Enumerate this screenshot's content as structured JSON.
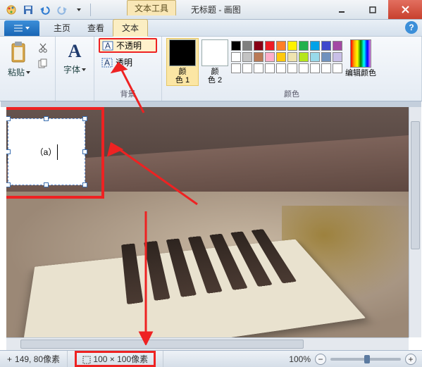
{
  "titlebar": {
    "tool_tab": "文本工具",
    "doc_title": "无标题",
    "app_name": "画图"
  },
  "tabs": {
    "file_indicator": "▾",
    "home": "主页",
    "view": "查看",
    "text": "文本"
  },
  "help_label": "?",
  "ribbon": {
    "clipboard": {
      "paste": "粘贴",
      "label": ""
    },
    "font": {
      "button": "字体",
      "label": ""
    },
    "background": {
      "opaque": "不透明",
      "transparent": "透明",
      "label": "背景"
    },
    "color1_label": "颜\n色 1",
    "color2_label": "颜\n色 2",
    "edit_colors": "编辑颜色",
    "colors_label": "颜色",
    "color1_value": "#000000",
    "color2_value": "#ffffff",
    "palette": [
      [
        "#000000",
        "#7f7f7f",
        "#880015",
        "#ed1c24",
        "#ff7f27",
        "#fff200",
        "#22b14c",
        "#00a2e8",
        "#3f48cc",
        "#a349a4"
      ],
      [
        "#ffffff",
        "#c3c3c3",
        "#b97a57",
        "#ffaec9",
        "#ffc90e",
        "#efe4b0",
        "#b5e61d",
        "#99d9ea",
        "#7092be",
        "#c8bfe7"
      ]
    ]
  },
  "textbox_content": "（a）",
  "status": {
    "cursor_icon": "+",
    "cursor_pos": "149, 80像素",
    "selection_size": "100 × 100像素",
    "zoom": "100%"
  }
}
